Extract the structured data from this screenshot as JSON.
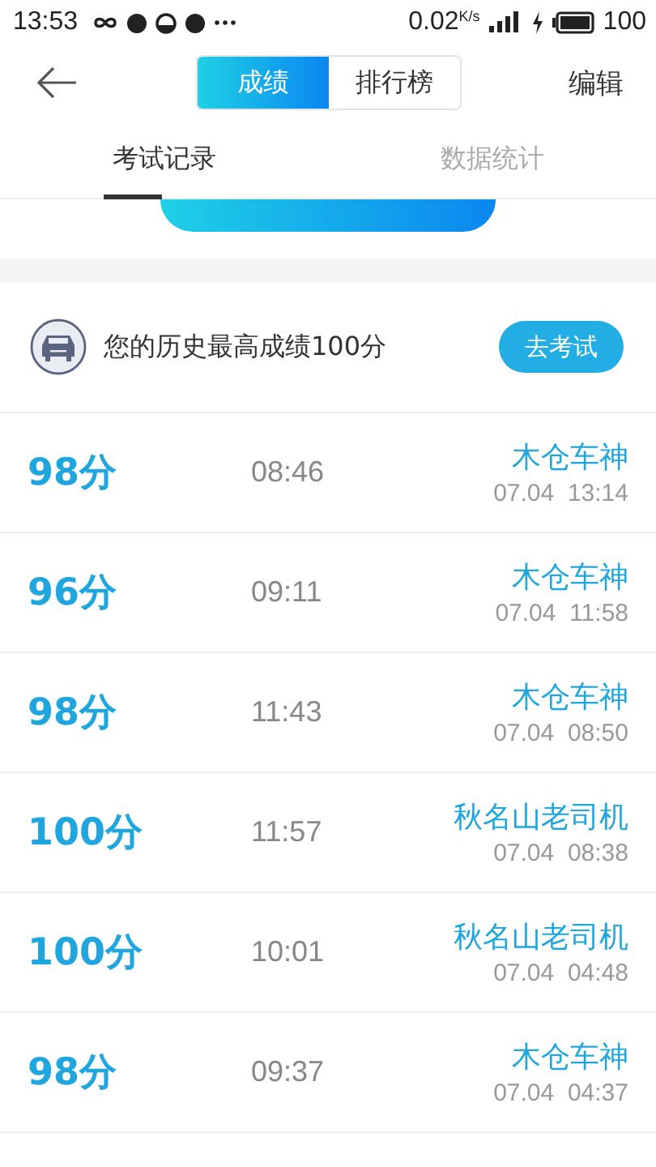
{
  "status_bar": {
    "time": "13:53",
    "speed": "0.02",
    "speed_unit": "K/s",
    "battery": "100"
  },
  "header": {
    "segments": [
      {
        "label": "成绩",
        "selected": true
      },
      {
        "label": "排行榜",
        "selected": false
      }
    ],
    "edit": "编辑"
  },
  "tabs": [
    {
      "label": "考试记录",
      "selected": true
    },
    {
      "label": "数据统计",
      "selected": false
    }
  ],
  "best": {
    "text": "您的历史最高成绩100分",
    "button": "去考试"
  },
  "records": [
    {
      "score": "98分",
      "duration": "08:46",
      "name": "木仓车神",
      "date": "07.04  13:14"
    },
    {
      "score": "96分",
      "duration": "09:11",
      "name": "木仓车神",
      "date": "07.04  11:58"
    },
    {
      "score": "98分",
      "duration": "11:43",
      "name": "木仓车神",
      "date": "07.04  08:50"
    },
    {
      "score": "100分",
      "duration": "11:57",
      "name": "秋名山老司机",
      "date": "07.04  08:38"
    },
    {
      "score": "100分",
      "duration": "10:01",
      "name": "秋名山老司机",
      "date": "07.04  04:48"
    },
    {
      "score": "98分",
      "duration": "09:37",
      "name": "木仓车神",
      "date": "07.04  04:37"
    }
  ]
}
